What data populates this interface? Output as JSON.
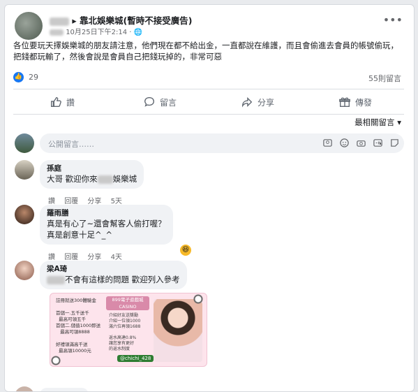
{
  "post": {
    "author_page": "靠北娛樂城(暫時不接受廣告)",
    "timestamp": "10月25日下午2:14 ·",
    "text": "各位要玩天擇娛樂城的朋友請注意，他們現在都不給出金，一直都說在維護，而且會偷進去會員的帳號偷玩，把錢都玩輸了，然後會說是會員自己把錢玩掉的，非常可惡",
    "like_count": "29",
    "comment_count": "55則留言"
  },
  "actions": {
    "like": "讚",
    "comment": "留言",
    "share": "分享",
    "send": "傳發"
  },
  "sort_label": "最相關留言",
  "composer_placeholder": "公開留言……",
  "comments": [
    {
      "name": "孫庭",
      "text_before": "大哥 歡迎你來",
      "text_after": "娛樂城",
      "like": "讚",
      "reply": "回覆",
      "share": "分享",
      "time": "5天"
    },
    {
      "name": "羅雨膳",
      "line1": "真是有心了~還會幫客人偷打喔？",
      "line2": "真是創意十足^_^",
      "like": "讚",
      "reply": "回覆",
      "share": "分享",
      "time": "4天"
    },
    {
      "name": "梁A琦",
      "text": "不會有這樣的問題 歡迎列入參考",
      "ad_logo": "899電子遊戲城\nCASINO",
      "ad_handle": "@chichi_428"
    }
  ],
  "ad_left_text": "註冊就送300體驗金\n\n首儲一.五千送千\n  最高可領五千\n首儲二.儲值1000即送\n   最高可領8888\n\n好禮領滿高千送\n  最高領10000元",
  "ad_mid_text": "介紹好友送獎勵\n介紹一位領1000\n滿六位再領1688\n\n返水高達0.8%\n讓您享有更好\n的返水制度"
}
